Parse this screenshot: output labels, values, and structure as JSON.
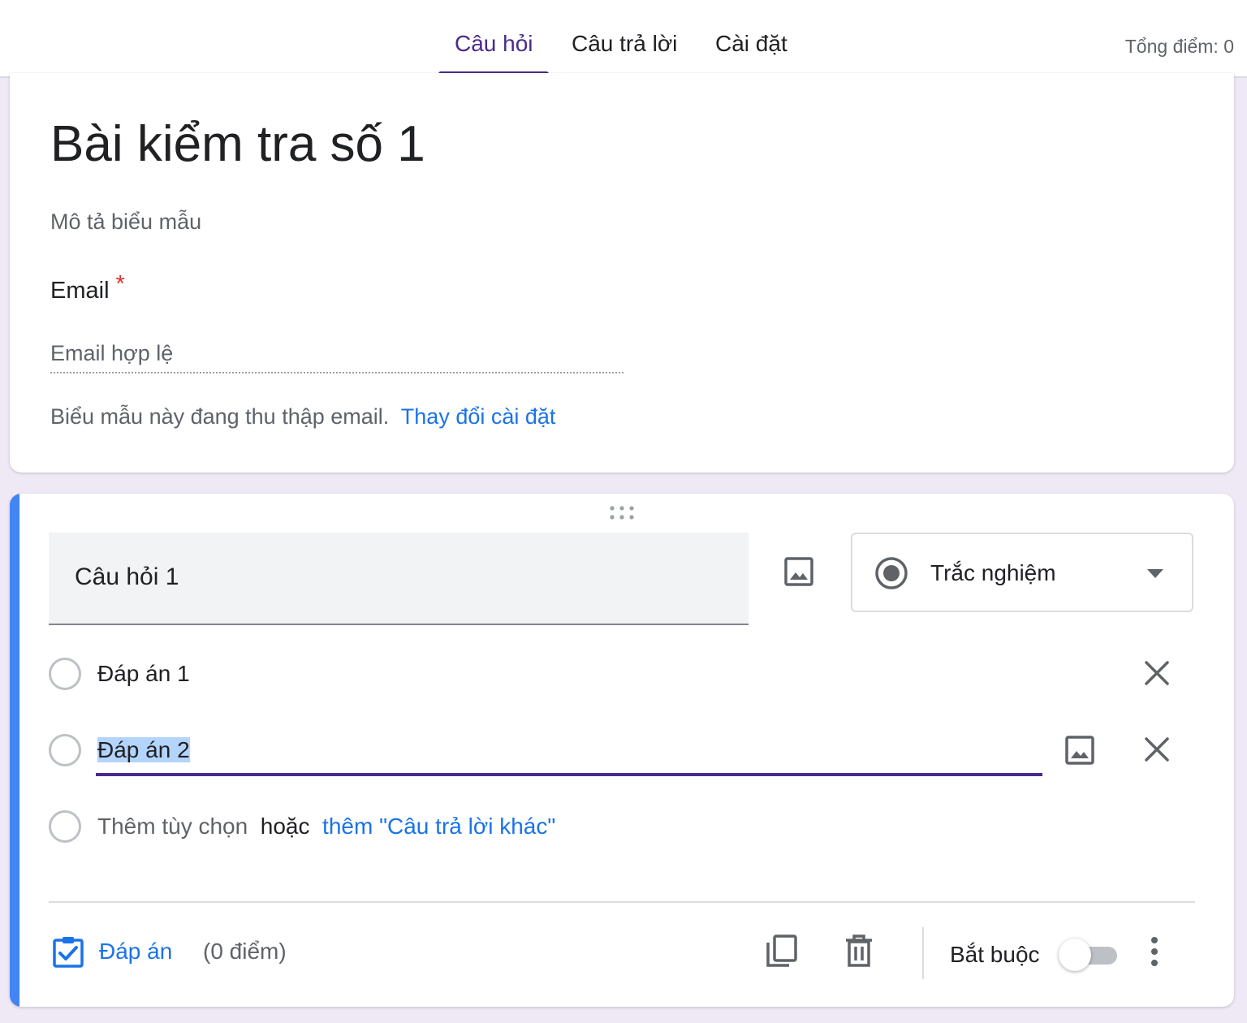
{
  "tabs": [
    {
      "label": "Câu hỏi",
      "active": true
    },
    {
      "label": "Câu trả lời",
      "active": false
    },
    {
      "label": "Cài đặt",
      "active": false
    }
  ],
  "total_points": "Tổng điểm: 0",
  "header": {
    "title": "Bài kiểm tra số 1",
    "description_placeholder": "Mô tả biểu mẫu",
    "email_label": "Email",
    "required_mark": "*",
    "email_placeholder": "Email hợp lệ",
    "collect_note": "Biểu mẫu này đang thu thập email.",
    "change_settings_link": "Thay đổi cài đặt"
  },
  "question": {
    "title": "Câu hỏi 1",
    "type_label": "Trắc nghiệm",
    "options": [
      {
        "label": "Đáp án 1"
      },
      {
        "label": "Đáp án 2"
      }
    ],
    "add_option": "Thêm tùy chọn",
    "or_text": "hoặc",
    "add_other": "thêm \"Câu trả lời khác\"",
    "answer_key_label": "Đáp án",
    "points": "(0 điểm)",
    "required_label": "Bắt buộc",
    "required_on": false
  },
  "colors": {
    "accent": "#4a2a8c",
    "link": "#1a73e8",
    "left_accent": "#4285f4",
    "background": "#efe9f6"
  },
  "icons": [
    "image-icon",
    "radio-button-icon",
    "chevron-down-icon",
    "close-icon",
    "answer-key-icon",
    "copy-icon",
    "trash-icon",
    "more-vert-icon",
    "drag-handle-icon"
  ]
}
